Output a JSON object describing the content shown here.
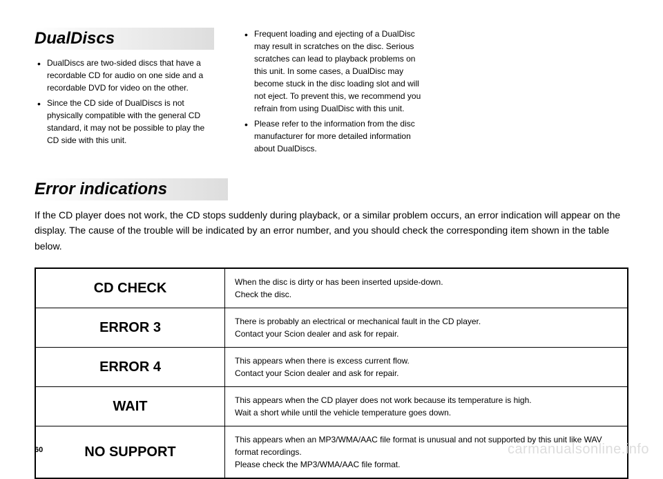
{
  "sections": {
    "dualdiscs": {
      "title": "DualDiscs",
      "col1": [
        "DualDiscs are two-sided discs that have a recordable CD for audio on one side and a recordable DVD for video on the other.",
        "Since the CD side of DualDiscs is not physically compatible with the general CD standard, it may not be possible to play the CD side with this unit."
      ],
      "col2": [
        "Frequent loading and ejecting of a DualDisc may result in scratches on the disc. Serious scratches can lead to playback problems on this unit. In some cases, a DualDisc may become stuck in the disc loading slot and will not eject. To prevent this, we recommend you refrain from using DualDisc with this unit.",
        "Please refer to the information from the disc manufacturer for more detailed information about DualDiscs."
      ]
    },
    "errors": {
      "title": "Error indications",
      "intro": "If the CD player does not work, the CD stops suddenly during playback, or a similar problem occurs, an error indication will appear on the display. The cause of the trouble will be indicated by an error number, and you should check the corresponding item shown in the table below.",
      "rows": [
        {
          "code": "CD CHECK",
          "line1": "When the disc is dirty or has been inserted upside-down.",
          "line2": "Check the disc."
        },
        {
          "code": "ERROR 3",
          "line1": "There is probably an electrical or mechanical fault in the CD player.",
          "line2": "Contact your Scion dealer and ask for repair."
        },
        {
          "code": "ERROR 4",
          "line1": "This appears when there is excess current flow.",
          "line2": "Contact your Scion dealer and ask for repair."
        },
        {
          "code": "WAIT",
          "line1": "This appears when the CD player does not work because its temperature is high.",
          "line2": "Wait a short while until the vehicle temperature goes down."
        },
        {
          "code": "NO SUPPORT",
          "line1": "This appears when an MP3/WMA/AAC file format is unusual and not supported by this unit like WAV format recordings.",
          "line2": "Please check the MP3/WMA/AAC file format."
        }
      ]
    }
  },
  "page_number": "60",
  "watermark": "carmanualsonline.info"
}
